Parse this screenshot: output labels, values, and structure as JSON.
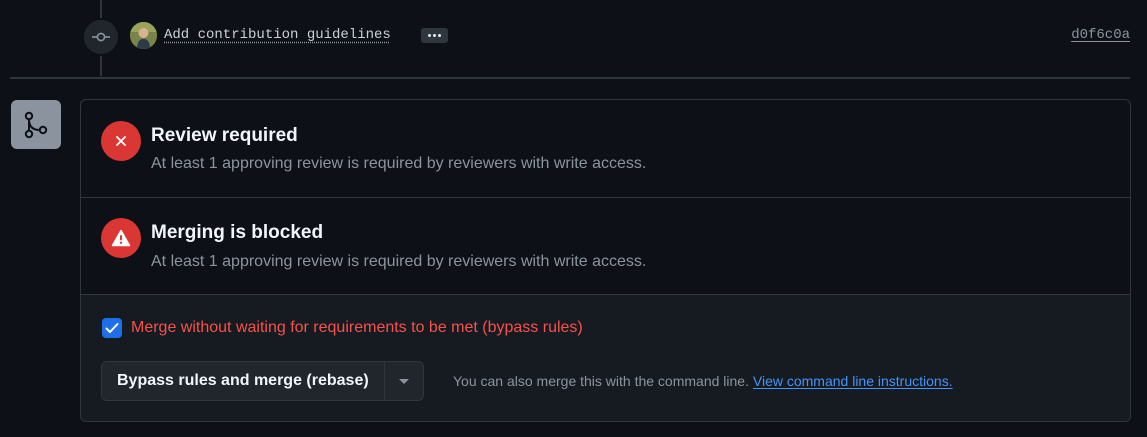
{
  "commit": {
    "message": "Add contribution guidelines",
    "sha": "d0f6c0a",
    "more_icon": "kebab-horizontal-icon",
    "node_icon": "git-commit-icon"
  },
  "merge_tile": {
    "icon": "git-merge-icon"
  },
  "checks": [
    {
      "icon": "x-circle-icon",
      "title": "Review required",
      "description": "At least 1 approving review is required by reviewers with write access."
    },
    {
      "icon": "alert-icon",
      "title": "Merging is blocked",
      "description": "At least 1 approving review is required by reviewers with write access."
    }
  ],
  "bypass": {
    "checked": true,
    "label": "Merge without waiting for requirements to be met (bypass rules)",
    "button_label": "Bypass rules and merge (rebase)",
    "dropdown_icon": "triangle-down-icon",
    "cli_text": "You can also merge this with the command line.",
    "cli_link": "View command line instructions."
  },
  "colors": {
    "background": "#0d1117",
    "danger": "#da3633",
    "danger_text": "#f85149",
    "accent": "#1f6feb",
    "link": "#4493f8",
    "muted": "#8b949e"
  }
}
